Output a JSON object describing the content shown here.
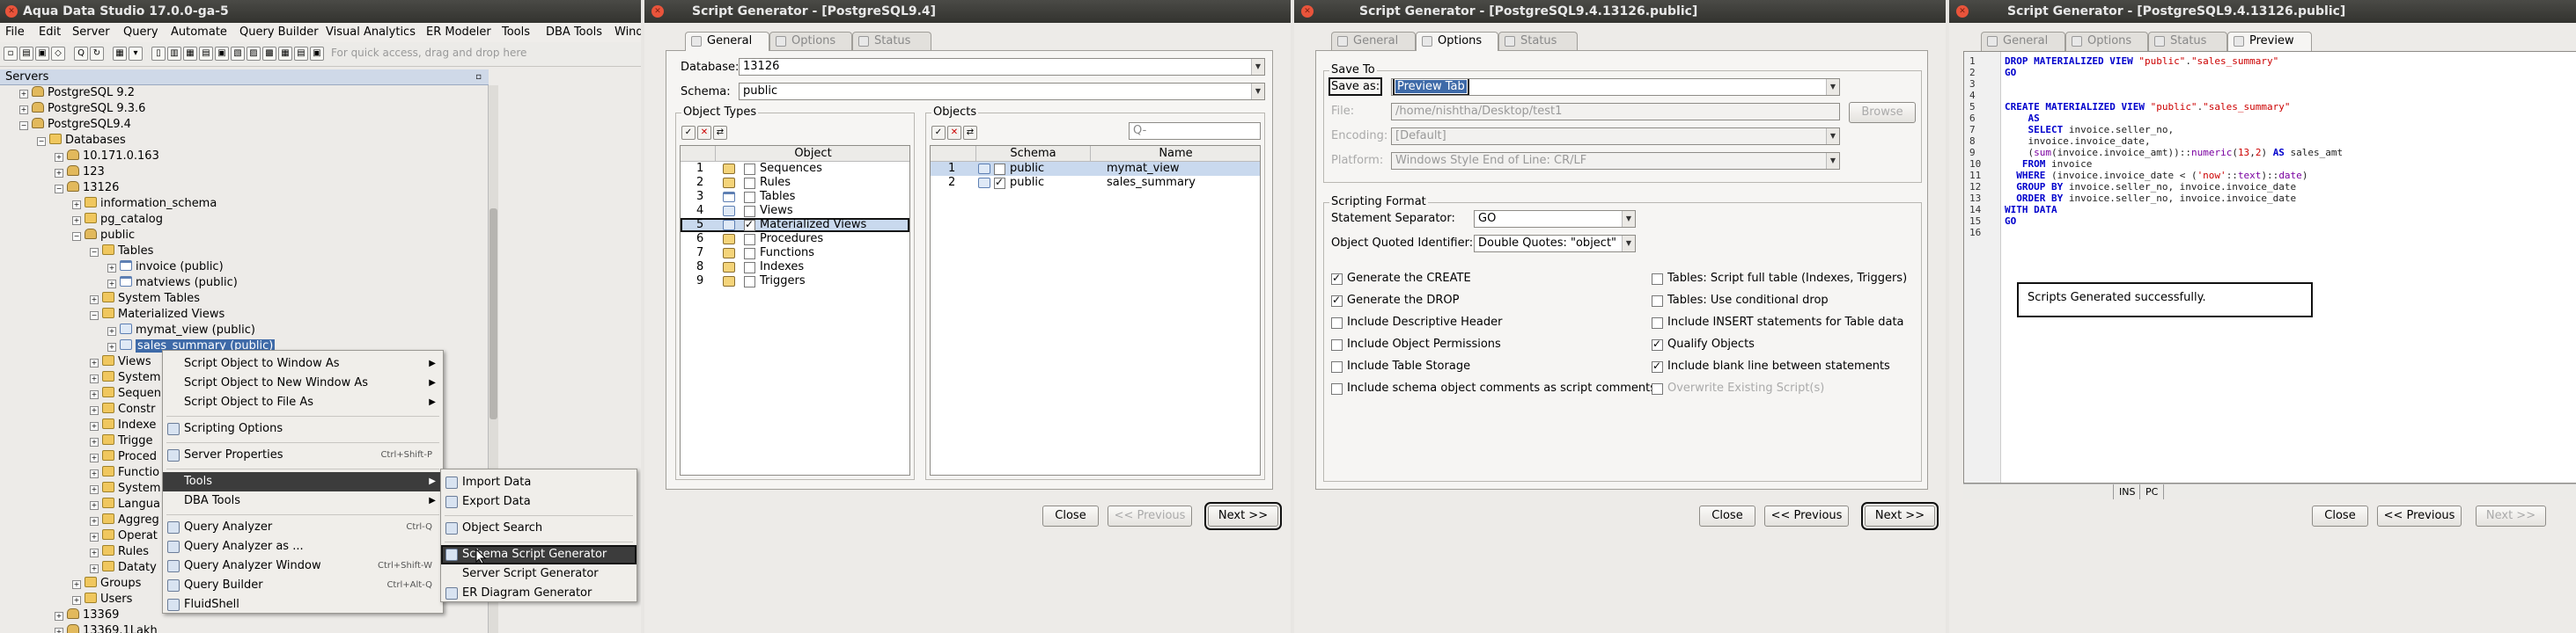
{
  "main_app": {
    "title": "Aqua Data Studio 17.0.0-ga-5",
    "menu": [
      "File",
      "Edit",
      "Server",
      "Query",
      "Automate",
      "Query Builder",
      "Visual Analytics",
      "ER Modeler",
      "Tools",
      "DBA Tools",
      "Wind"
    ],
    "quick_access_placeholder": "For quick access, drag and drop here",
    "servers_label": "Servers",
    "tree": [
      "PostgreSQL 9.2",
      "PostgreSQL 9.3.6",
      "PostgreSQL9.4",
      "Databases",
      "10.171.0.163",
      "123",
      "13126",
      "information_schema",
      "pg_catalog",
      "public",
      "Tables",
      "invoice (public)",
      "matviews (public)",
      "System Tables",
      "Materialized Views",
      "mymat_view (public)",
      "sales_summary (public)",
      "Views",
      "System",
      "Sequen",
      "Constr",
      "Indexe",
      "Trigge",
      "Proced",
      "Functio",
      "System",
      "Langua",
      "Aggreg",
      "Operat",
      "Rules",
      "Dataty",
      "Groups",
      "Users",
      "13369",
      "13369.1Lakh"
    ],
    "context_menu": [
      {
        "label": "Script Object to Window As"
      },
      {
        "label": "Script Object to New Window As"
      },
      {
        "label": "Script Object to File As"
      },
      {
        "label": "Scripting Options"
      },
      {
        "label": "Server Properties",
        "shortcut": "Ctrl+Shift-P"
      },
      {
        "label": "Tools"
      },
      {
        "label": "DBA Tools"
      },
      {
        "label": "Query Analyzer",
        "shortcut": "Ctrl-Q"
      },
      {
        "label": "Query Analyzer as ..."
      },
      {
        "label": "Query Analyzer Window",
        "shortcut": "Ctrl+Shift-W"
      },
      {
        "label": "Query Builder",
        "shortcut": "Ctrl+Alt-Q"
      },
      {
        "label": "FluidShell"
      }
    ],
    "tools_submenu": [
      "Import Data",
      "Export Data",
      "Object Search",
      "Schema Script Generator",
      "Server Script Generator",
      "ER Diagram Generator"
    ]
  },
  "win1": {
    "title": "Script Generator - [PostgreSQL9.4]",
    "tabs": [
      "General",
      "Options",
      "Status"
    ],
    "database_label": "Database:",
    "database_value": "13126",
    "schema_label": "Schema:",
    "schema_value": "public",
    "object_types_title": "Object Types",
    "object_col": "Object",
    "object_types": [
      {
        "n": "1",
        "name": "Sequences",
        "checked": false
      },
      {
        "n": "2",
        "name": "Rules",
        "checked": false
      },
      {
        "n": "3",
        "name": "Tables",
        "checked": false
      },
      {
        "n": "4",
        "name": "Views",
        "checked": false
      },
      {
        "n": "5",
        "name": "Materialized Views",
        "checked": true
      },
      {
        "n": "6",
        "name": "Procedures",
        "checked": false
      },
      {
        "n": "7",
        "name": "Functions",
        "checked": false
      },
      {
        "n": "8",
        "name": "Indexes",
        "checked": false
      },
      {
        "n": "9",
        "name": "Triggers",
        "checked": false
      }
    ],
    "objects_title": "Objects",
    "search_placeholder": "Q-",
    "objects_cols": [
      "Schema",
      "Name"
    ],
    "objects": [
      {
        "n": "1",
        "schema": "public",
        "name": "mymat_view",
        "checked": false
      },
      {
        "n": "2",
        "schema": "public",
        "name": "sales_summary",
        "checked": true
      }
    ],
    "close": "Close",
    "previous": "<< Previous",
    "next": "Next >>"
  },
  "win2": {
    "title": "Script Generator - [PostgreSQL9.4.13126.public]",
    "tabs": [
      "General",
      "Options",
      "Status"
    ],
    "save_to_title": "Save To",
    "save_as_label": "Save as:",
    "save_as_value": "Preview Tab",
    "file_label": "File:",
    "file_value": "/home/nishtha/Desktop/test1",
    "browse": "Browse",
    "encoding_label": "Encoding:",
    "encoding_value": "[Default]",
    "platform_label": "Platform:",
    "platform_value": "Windows Style End of Line: CR/LF",
    "scripting_title": "Scripting Format",
    "separator_label": "Statement Separator:",
    "separator_value": "GO",
    "quoted_label": "Object Quoted Identifier:",
    "quoted_value": "Double Quotes: \"object\"",
    "options_left": [
      {
        "label": "Generate the CREATE",
        "checked": true
      },
      {
        "label": "Generate the DROP",
        "checked": true
      },
      {
        "label": "Include Descriptive Header",
        "checked": false
      },
      {
        "label": "Include Object Permissions",
        "checked": false
      },
      {
        "label": "Include Table Storage",
        "checked": false
      },
      {
        "label": "Include schema object comments as script comments",
        "checked": false
      }
    ],
    "options_right": [
      {
        "label": "Tables: Script full table (Indexes, Triggers)",
        "checked": false
      },
      {
        "label": "Tables: Use conditional drop",
        "checked": false
      },
      {
        "label": "Include INSERT statements for Table data",
        "checked": false
      },
      {
        "label": "Qualify Objects",
        "checked": true
      },
      {
        "label": "Include blank line between statements",
        "checked": true
      },
      {
        "label": "Overwrite Existing Script(s)",
        "checked": false
      }
    ],
    "close": "Close",
    "previous": "<< Previous",
    "next": "Next >>"
  },
  "win3": {
    "title": "Script Generator - [PostgreSQL9.4.13126.public]",
    "tabs": [
      "General",
      "Options",
      "Status",
      "Preview"
    ],
    "line_numbers": [
      "1",
      "2",
      "3",
      "4",
      "5",
      "6",
      "7",
      "8",
      "9",
      "10",
      "11",
      "12",
      "13",
      "14",
      "15",
      "16"
    ],
    "success_message": "Scripts Generated successfully.",
    "status_ins": "INS",
    "status_pc": "PC",
    "close": "Close",
    "previous": "<< Previous",
    "next": "Next >>"
  }
}
